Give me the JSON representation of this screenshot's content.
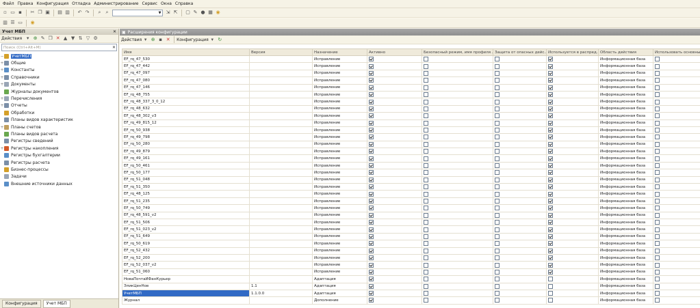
{
  "menu": [
    "Файл",
    "Правка",
    "Конфигурация",
    "Отладка",
    "Администрирование",
    "Сервис",
    "Окна",
    "Справка"
  ],
  "left_panel": {
    "title": "Учет МБП",
    "actions_label": "Действия",
    "search_placeholder": "Поиск (Ctrl+Alt+M)",
    "tree": [
      {
        "label": "УчетМБП",
        "pm": "−",
        "color": "#d4a02a",
        "selected": true
      },
      {
        "label": "Общие",
        "pm": "+",
        "color": "#7b8fa8"
      },
      {
        "label": "Константы",
        "pm": "+",
        "color": "#5a8fc8"
      },
      {
        "label": "Справочники",
        "pm": "+",
        "color": "#7b8fa8"
      },
      {
        "label": "Документы",
        "pm": "+",
        "color": "#9aa6b6"
      },
      {
        "label": "Журналы документов",
        "pm": "",
        "color": "#6aa84f"
      },
      {
        "label": "Перечисления",
        "pm": "+",
        "color": "#9aa6b6"
      },
      {
        "label": "Отчеты",
        "pm": "+",
        "color": "#7b8fa8"
      },
      {
        "label": "Обработки",
        "pm": "",
        "color": "#d4a02a"
      },
      {
        "label": "Планы видов характеристик",
        "pm": "",
        "color": "#7b8fa8"
      },
      {
        "label": "Планы счетов",
        "pm": "+",
        "color": "#c0a060"
      },
      {
        "label": "Планы видов расчета",
        "pm": "",
        "color": "#6aa84f"
      },
      {
        "label": "Регистры сведений",
        "pm": "",
        "color": "#7b8fa8"
      },
      {
        "label": "Регистры накопления",
        "pm": "+",
        "color": "#d45a2a"
      },
      {
        "label": "Регистры бухгалтерии",
        "pm": "",
        "color": "#5a8fc8"
      },
      {
        "label": "Регистры расчета",
        "pm": "",
        "color": "#7b8fa8"
      },
      {
        "label": "Бизнес-процессы",
        "pm": "",
        "color": "#d4a02a"
      },
      {
        "label": "Задачи",
        "pm": "",
        "color": "#9aa6b6"
      },
      {
        "label": "Внешние источники данных",
        "pm": "",
        "color": "#5a8fc8"
      }
    ],
    "tabs": [
      "Конфигурация",
      "Учет МБП"
    ]
  },
  "right_panel": {
    "title": "Расширения конфигурации",
    "actions_label": "Действия",
    "config_label": "Конфигурация",
    "columns": [
      "Имя",
      "Версия",
      "Назначение",
      "Активно",
      "Безопасный режим, имя профиля ...",
      "Защита от опасных дейс...",
      "Используется в распред...",
      "Область действия",
      "Использовать основные"
    ],
    "rows": [
      {
        "name": "EF_rq_47_530",
        "version": "",
        "purpose": "Исправление",
        "active": true,
        "dist": true,
        "scope": "Информационная база"
      },
      {
        "name": "EF_rq_47_442",
        "version": "",
        "purpose": "Исправление",
        "active": true,
        "dist": true,
        "scope": "Информационная база"
      },
      {
        "name": "EF_rq_47_097",
        "version": "",
        "purpose": "Исправление",
        "active": true,
        "dist": true,
        "scope": "Информационная база"
      },
      {
        "name": "EF_rq_47_080",
        "version": "",
        "purpose": "Исправление",
        "active": true,
        "dist": true,
        "scope": "Информационная база"
      },
      {
        "name": "EF_rq_47_146",
        "version": "",
        "purpose": "Исправление",
        "active": true,
        "dist": true,
        "scope": "Информационная база"
      },
      {
        "name": "EF_rq_48_755",
        "version": "",
        "purpose": "Исправление",
        "active": true,
        "dist": true,
        "scope": "Информационная база"
      },
      {
        "name": "EF_rq_48_337_3_0_12",
        "version": "",
        "purpose": "Исправление",
        "active": true,
        "dist": true,
        "scope": "Информационная база"
      },
      {
        "name": "EF_rq_48_632",
        "version": "",
        "purpose": "Исправление",
        "active": true,
        "dist": true,
        "scope": "Информационная база"
      },
      {
        "name": "EF_rq_48_302_v3",
        "version": "",
        "purpose": "Исправление",
        "active": true,
        "dist": true,
        "scope": "Информационная база"
      },
      {
        "name": "EF_rq_49_815_12",
        "version": "",
        "purpose": "Исправление",
        "active": true,
        "dist": true,
        "scope": "Информационная база"
      },
      {
        "name": "EF_rq_50_938",
        "version": "",
        "purpose": "Исправление",
        "active": true,
        "dist": true,
        "scope": "Информационная база"
      },
      {
        "name": "EF_rq_49_798",
        "version": "",
        "purpose": "Исправление",
        "active": true,
        "dist": true,
        "scope": "Информационная база"
      },
      {
        "name": "EF_rq_50_280",
        "version": "",
        "purpose": "Исправление",
        "active": true,
        "dist": true,
        "scope": "Информационная база"
      },
      {
        "name": "EF_rq_49_879",
        "version": "",
        "purpose": "Исправление",
        "active": true,
        "dist": true,
        "scope": "Информационная база"
      },
      {
        "name": "EF_rq_49_161",
        "version": "",
        "purpose": "Исправление",
        "active": true,
        "dist": true,
        "scope": "Информационная база"
      },
      {
        "name": "EF_rq_50_461",
        "version": "",
        "purpose": "Исправление",
        "active": true,
        "dist": true,
        "scope": "Информационная база"
      },
      {
        "name": "EF_rq_50_177",
        "version": "",
        "purpose": "Исправление",
        "active": true,
        "dist": true,
        "scope": "Информационная база"
      },
      {
        "name": "EF_rq_51_048",
        "version": "",
        "purpose": "Исправление",
        "active": true,
        "dist": true,
        "scope": "Информационная база"
      },
      {
        "name": "EF_rq_51_350",
        "version": "",
        "purpose": "Исправление",
        "active": true,
        "dist": true,
        "scope": "Информационная база"
      },
      {
        "name": "EF_rq_48_125",
        "version": "",
        "purpose": "Исправление",
        "active": true,
        "dist": true,
        "scope": "Информационная база"
      },
      {
        "name": "EF_rq_51_235",
        "version": "",
        "purpose": "Исправление",
        "active": true,
        "dist": true,
        "scope": "Информационная база"
      },
      {
        "name": "EF_rq_50_749",
        "version": "",
        "purpose": "Исправление",
        "active": true,
        "dist": true,
        "scope": "Информационная база"
      },
      {
        "name": "EF_rq_48_591_v2",
        "version": "",
        "purpose": "Исправление",
        "active": true,
        "dist": true,
        "scope": "Информационная база"
      },
      {
        "name": "EF_rq_51_506",
        "version": "",
        "purpose": "Исправление",
        "active": true,
        "dist": true,
        "scope": "Информационная база"
      },
      {
        "name": "EF_rq_51_023_v2",
        "version": "",
        "purpose": "Исправление",
        "active": true,
        "dist": true,
        "scope": "Информационная база"
      },
      {
        "name": "EF_rq_51_649",
        "version": "",
        "purpose": "Исправление",
        "active": true,
        "dist": true,
        "scope": "Информационная база"
      },
      {
        "name": "EF_rq_50_619",
        "version": "",
        "purpose": "Исправление",
        "active": true,
        "dist": true,
        "scope": "Информационная база"
      },
      {
        "name": "EF_rq_52_432",
        "version": "",
        "purpose": "Исправление",
        "active": true,
        "dist": true,
        "scope": "Информационная база"
      },
      {
        "name": "EF_rq_52_200",
        "version": "",
        "purpose": "Исправление",
        "active": true,
        "dist": true,
        "scope": "Информационная база"
      },
      {
        "name": "EF_rq_52_037_v2",
        "version": "",
        "purpose": "Исправление",
        "active": true,
        "dist": true,
        "scope": "Информационная база"
      },
      {
        "name": "EF_rq_51_060",
        "version": "",
        "purpose": "Исправление",
        "active": true,
        "dist": true,
        "scope": "Информационная база"
      },
      {
        "name": "НоваПочтаИФанКурьер",
        "version": "",
        "purpose": "Адаптация",
        "active": true,
        "dist": false,
        "scope": "Информационная база"
      },
      {
        "name": "ЭликЦенНов",
        "version": "1.1",
        "purpose": "Адаптация",
        "active": true,
        "dist": false,
        "scope": "Информационная база"
      },
      {
        "name": "УчетМБП",
        "version": "1.1.0.0",
        "purpose": "Адаптация",
        "active": true,
        "dist": false,
        "scope": "Информационная база",
        "selected": true
      },
      {
        "name": "Журнал",
        "version": "",
        "purpose": "Дополнение",
        "active": true,
        "dist": false,
        "scope": "Информационная база"
      }
    ]
  }
}
